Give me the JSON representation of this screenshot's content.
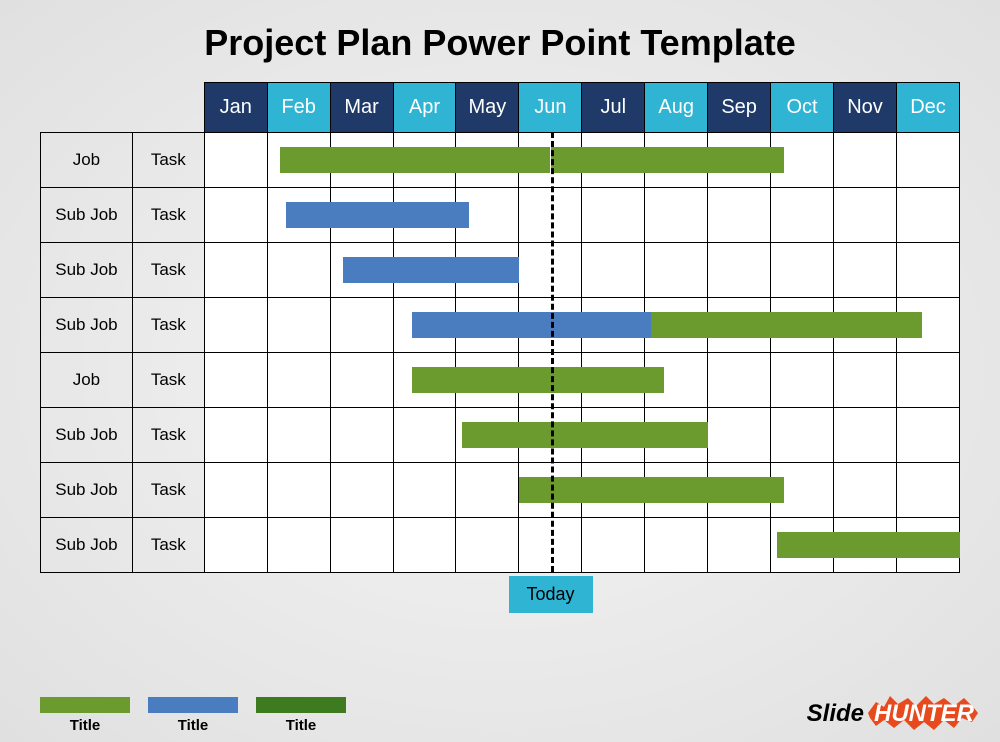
{
  "title": "Project Plan Power Point Template",
  "months": [
    "Jan",
    "Feb",
    "Mar",
    "Apr",
    "May",
    "Jun",
    "Jul",
    "Aug",
    "Sep",
    "Oct",
    "Nov",
    "Dec"
  ],
  "month_colors": [
    "dark-blue",
    "light-blue",
    "dark-blue",
    "light-blue",
    "dark-blue",
    "light-blue",
    "dark-blue",
    "light-blue",
    "dark-blue",
    "light-blue",
    "dark-blue",
    "light-blue"
  ],
  "rows": [
    {
      "job": "Job",
      "task": "Task"
    },
    {
      "job": "Sub Job",
      "task": "Task"
    },
    {
      "job": "Sub Job",
      "task": "Task"
    },
    {
      "job": "Sub Job",
      "task": "Task"
    },
    {
      "job": "Job",
      "task": "Task"
    },
    {
      "job": "Sub Job",
      "task": "Task"
    },
    {
      "job": "Sub Job",
      "task": "Task"
    },
    {
      "job": "Sub Job",
      "task": "Task"
    }
  ],
  "today_label": "Today",
  "today_position": 5.5,
  "legend": [
    {
      "color": "#6b9a2f",
      "label": "Title"
    },
    {
      "color": "#4a7dbf",
      "label": "Title"
    },
    {
      "color": "#3e7a1f",
      "label": "Title"
    }
  ],
  "brand": {
    "part1": "Slide",
    "part2": "HUNTER"
  },
  "chart_data": {
    "type": "gantt",
    "title": "Project Plan Power Point Template",
    "x_categories": [
      "Jan",
      "Feb",
      "Mar",
      "Apr",
      "May",
      "Jun",
      "Jul",
      "Aug",
      "Sep",
      "Oct",
      "Nov",
      "Dec"
    ],
    "today_marker_month": 5.5,
    "today_marker_label": "Today",
    "tasks": [
      {
        "row": 0,
        "job": "Job",
        "task": "Task",
        "segments": [
          {
            "start": 1.2,
            "end": 5.5,
            "color": "green"
          },
          {
            "start": 5.5,
            "end": 9.2,
            "color": "green"
          }
        ]
      },
      {
        "row": 1,
        "job": "Sub Job",
        "task": "Task",
        "segments": [
          {
            "start": 1.3,
            "end": 4.2,
            "color": "blue"
          }
        ]
      },
      {
        "row": 2,
        "job": "Sub Job",
        "task": "Task",
        "segments": [
          {
            "start": 2.2,
            "end": 5.0,
            "color": "blue"
          }
        ]
      },
      {
        "row": 3,
        "job": "Sub Job",
        "task": "Task",
        "segments": [
          {
            "start": 3.3,
            "end": 7.1,
            "color": "blue"
          },
          {
            "start": 7.1,
            "end": 11.4,
            "color": "green"
          }
        ]
      },
      {
        "row": 4,
        "job": "Job",
        "task": "Task",
        "segments": [
          {
            "start": 3.3,
            "end": 7.3,
            "color": "green"
          }
        ]
      },
      {
        "row": 5,
        "job": "Sub Job",
        "task": "Task",
        "segments": [
          {
            "start": 4.1,
            "end": 8.0,
            "color": "green"
          }
        ]
      },
      {
        "row": 6,
        "job": "Sub Job",
        "task": "Task",
        "segments": [
          {
            "start": 5.0,
            "end": 9.2,
            "color": "green"
          }
        ]
      },
      {
        "row": 7,
        "job": "Sub Job",
        "task": "Task",
        "segments": [
          {
            "start": 9.1,
            "end": 12.0,
            "color": "green"
          }
        ]
      }
    ],
    "legend": [
      {
        "color": "green",
        "label": "Title"
      },
      {
        "color": "blue",
        "label": "Title"
      },
      {
        "color": "dark-green",
        "label": "Title"
      }
    ]
  }
}
